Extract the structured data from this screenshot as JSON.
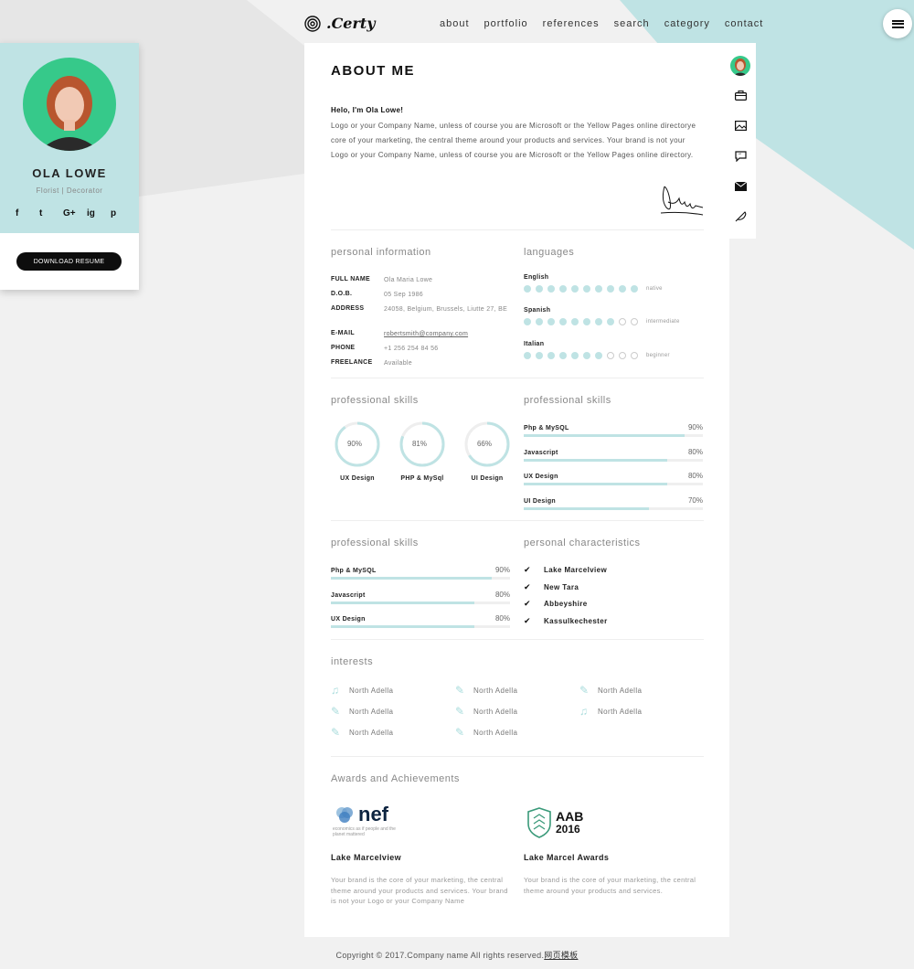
{
  "brand": {
    "name": ".Certy"
  },
  "nav": [
    "about",
    "portfolio",
    "references",
    "search",
    "category",
    "contact"
  ],
  "profile": {
    "name": "OLA LOWE",
    "role": "Florist | Decorator",
    "socials": [
      "f",
      "t",
      "G+",
      "ig",
      "p"
    ],
    "download_label": "DOWNLOAD RESUME"
  },
  "about": {
    "title": "ABOUT ME",
    "greeting": "Helo, I'm Ola Lowe!",
    "text": "Logo or your Company Name, unless of course you are Microsoft or the Yellow Pages online directorye core of your marketing, the central theme around your products and services. Your brand is not your Logo or your Company Name, unless of course you are Microsoft or the Yellow Pages online directory."
  },
  "personal": {
    "title": "personal information",
    "rows": [
      {
        "key": "FULL NAME",
        "value": "Ola Maria Lowe"
      },
      {
        "key": "D.O.B.",
        "value": "05 Sep 1986"
      },
      {
        "key": "ADDRESS",
        "value": "24058, Belgium, Brussels, Liutte 27, BE"
      },
      {
        "key": "E-MAIL",
        "value": "robertsmith@company.com"
      },
      {
        "key": "PHONE",
        "value": "+1 256 254 84 56"
      },
      {
        "key": "FREELANCE",
        "value": "Available"
      }
    ]
  },
  "languages": {
    "title": "languages",
    "items": [
      {
        "name": "English",
        "level": "native",
        "score": 10
      },
      {
        "name": "Spanish",
        "level": "intermediate",
        "score": 8
      },
      {
        "name": "Italian",
        "level": "beginner",
        "score": 7
      }
    ]
  },
  "skills_circles": {
    "title": "professional skills",
    "items": [
      {
        "label": "UX Design",
        "value": 90,
        "pct": "90%"
      },
      {
        "label": "PHP & MySql",
        "value": 81,
        "pct": "81%"
      },
      {
        "label": "UI Design",
        "value": 66,
        "pct": "66%"
      }
    ]
  },
  "skills_bars_a": {
    "title": "professional skills",
    "items": [
      {
        "label": "Php & MySQL",
        "value": 90,
        "pct": "90%"
      },
      {
        "label": "Javascript",
        "value": 80,
        "pct": "80%"
      },
      {
        "label": "UX Design",
        "value": 80,
        "pct": "80%"
      },
      {
        "label": "UI Design",
        "value": 70,
        "pct": "70%"
      }
    ]
  },
  "skills_bars_b": {
    "title": "professional skills",
    "items": [
      {
        "label": "Php & MySQL",
        "value": 90,
        "pct": "90%"
      },
      {
        "label": "Javascript",
        "value": 80,
        "pct": "80%"
      },
      {
        "label": "UX Design",
        "value": 80,
        "pct": "80%"
      }
    ]
  },
  "characteristics": {
    "title": "personal characteristics",
    "items": [
      "Lake Marcelview",
      "New Tara",
      "Abbeyshire",
      "Kassulkechester"
    ]
  },
  "interests": {
    "title": "interests",
    "items": [
      {
        "label": "North Adella",
        "icon": "music-icon"
      },
      {
        "label": "North Adella",
        "icon": "feather-icon"
      },
      {
        "label": "North Adella",
        "icon": "feather-icon"
      },
      {
        "label": "North Adella",
        "icon": "feather-icon"
      },
      {
        "label": "North Adella",
        "icon": "feather-icon"
      },
      {
        "label": "North Adella",
        "icon": "music-icon"
      },
      {
        "label": "North Adella",
        "icon": "feather-icon"
      },
      {
        "label": "North Adella",
        "icon": "feather-icon"
      }
    ]
  },
  "awards": {
    "title": "Awards and Achievements",
    "items": [
      {
        "logo_text": "nef",
        "logo_sub": "economics as if people and the planet mattered",
        "title": "Lake Marcelview",
        "text": "Your brand is the core of your marketing, the central theme around your products and services. Your brand is not your Logo or your Company Name"
      },
      {
        "logo_text": "AAB",
        "logo_year": "2016",
        "title": "Lake Marcel Awards",
        "text": "Your brand is the core of your marketing, the central theme around your products and services."
      }
    ]
  },
  "footer": {
    "text": "Copyright © 2017.Company name All rights reserved.",
    "link": "网页模板"
  },
  "colors": {
    "accent": "#bfe3e4",
    "avatar_bg": "#36c98a",
    "background": "#f1f1f1"
  }
}
